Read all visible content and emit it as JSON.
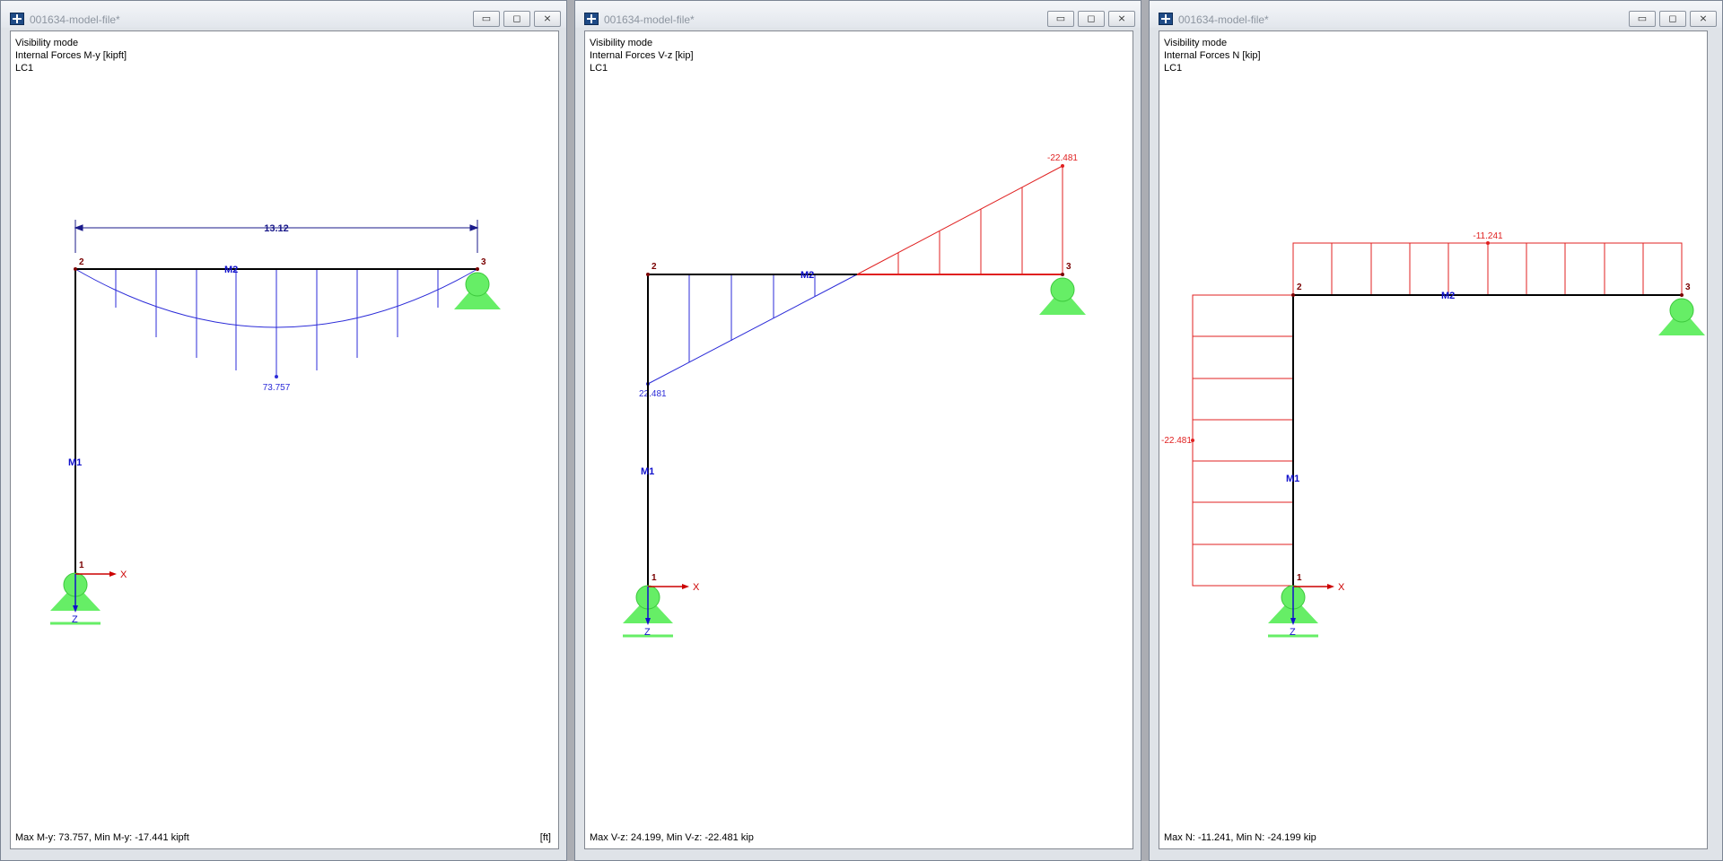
{
  "app": {
    "window_title": "001634-model-file*"
  },
  "windows": [
    {
      "mode": "Visibility mode",
      "quantity": "Internal Forces M-y [kipft]",
      "load_case": "LC1",
      "dimension": "13.12",
      "max_label": "73.757",
      "status": "Max M-y: 73.757, Min M-y: -17.441 kipft",
      "unit": "[ft]"
    },
    {
      "mode": "Visibility mode",
      "quantity": "Internal Forces V-z [kip]",
      "load_case": "LC1",
      "label_neg": "-22.481",
      "label_pos": "22.481",
      "status": "Max V-z: 24.199, Min V-z: -22.481 kip"
    },
    {
      "mode": "Visibility mode",
      "quantity": "Internal Forces N [kip]",
      "load_case": "LC1",
      "label_beam": "-11.241",
      "label_col": "-22.481",
      "status": "Max N: -11.241, Min N: -24.199 kip"
    }
  ],
  "labels": {
    "node1": "1",
    "node2": "2",
    "node3": "3",
    "member1": "M1",
    "member2": "M2",
    "axis_x": "X",
    "axis_z": "Z"
  },
  "buttons": {
    "minimize": "▭",
    "maximize": "◻",
    "close": "⨯"
  },
  "colors": {
    "moment_blue": "#2b2bd8",
    "tension_red": "#e02020",
    "support_green": "#66ee66",
    "member_black": "#000000"
  },
  "icons": [
    "app-icon",
    "minimize-icon",
    "maximize-icon",
    "close-icon"
  ]
}
